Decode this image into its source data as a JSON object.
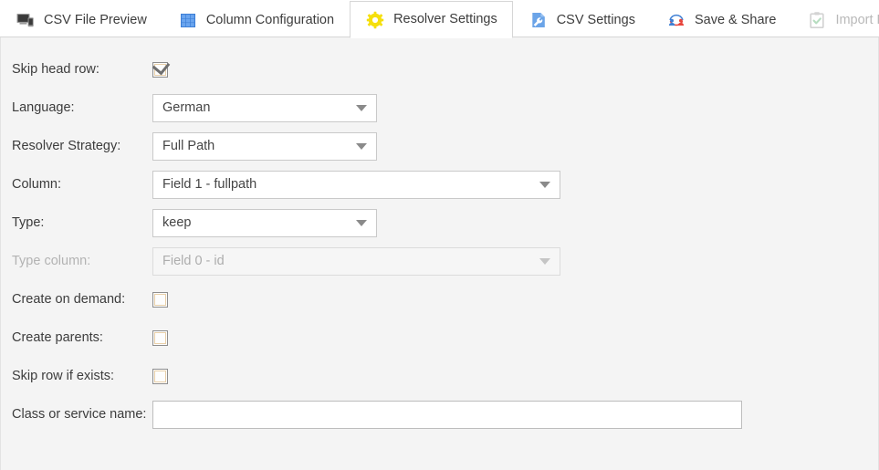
{
  "tabs": [
    {
      "id": "csv-file-preview",
      "label": "CSV File Preview",
      "icon": "monitor-icon",
      "active": false,
      "disabled": false
    },
    {
      "id": "column-configuration",
      "label": "Column Configuration",
      "icon": "grid-icon",
      "active": false,
      "disabled": false
    },
    {
      "id": "resolver-settings",
      "label": "Resolver Settings",
      "icon": "gear-icon",
      "active": true,
      "disabled": false
    },
    {
      "id": "csv-settings",
      "label": "CSV Settings",
      "icon": "wrench-icon",
      "active": false,
      "disabled": false
    },
    {
      "id": "save-and-share",
      "label": "Save & Share",
      "icon": "share-icon",
      "active": false,
      "disabled": false
    },
    {
      "id": "import-report",
      "label": "Import Report",
      "icon": "clipboard-check-icon",
      "active": false,
      "disabled": true
    }
  ],
  "form": {
    "skip_head_row": {
      "label": "Skip head row:",
      "checked": true
    },
    "language": {
      "label": "Language:",
      "value": "German"
    },
    "resolver_strategy": {
      "label": "Resolver Strategy:",
      "value": "Full Path"
    },
    "column": {
      "label": "Column:",
      "value": "Field 1 - fullpath"
    },
    "type": {
      "label": "Type:",
      "value": "keep"
    },
    "type_column": {
      "label": "Type column:",
      "value": "Field 0 - id",
      "disabled": true
    },
    "create_on_demand": {
      "label": "Create on demand:",
      "checked": false
    },
    "create_parents": {
      "label": "Create parents:",
      "checked": false
    },
    "skip_row_if_exists": {
      "label": "Skip row if exists:",
      "checked": false
    },
    "class_or_service_name": {
      "label": "Class or service name:",
      "value": "",
      "placeholder": ""
    }
  },
  "colors": {
    "panel_background": "#f4f4f4",
    "tab_active_background": "#ffffff",
    "gear_yellow": "#f5df0d",
    "grid_blue": "#4a90e2",
    "wrench_blue": "#6ba4e8",
    "share_blue": "#3e7fd4",
    "share_red": "#e8453c",
    "disabled_text": "#b3b3b3"
  }
}
